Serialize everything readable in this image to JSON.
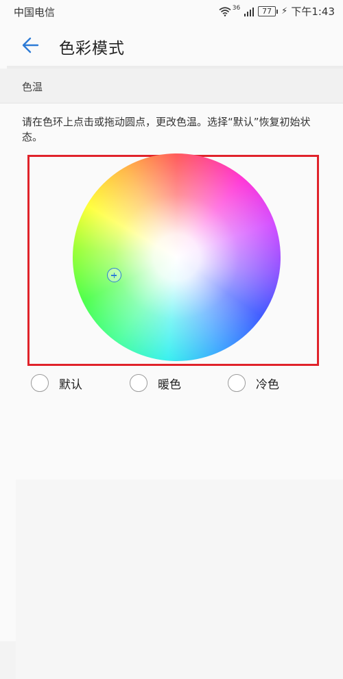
{
  "status_bar": {
    "carrier": "中国电信",
    "network": "36",
    "battery": "77",
    "time": "下午1:43"
  },
  "app_bar": {
    "title": "色彩模式",
    "back_icon": "arrow-left-icon"
  },
  "section": {
    "title": "色温",
    "description": "请在色环上点击或拖动圆点，更改色温。选择“默认”恢复初始状态。"
  },
  "color_wheel": {
    "handle_icon": "crosshair-plus-icon"
  },
  "options": [
    {
      "label": "默认",
      "selected": false
    },
    {
      "label": "暖色",
      "selected": false
    },
    {
      "label": "冷色",
      "selected": false
    }
  ],
  "colors": {
    "accent": "#2d7bd6",
    "highlight_frame": "#e0222a",
    "background": "#fafafa"
  }
}
